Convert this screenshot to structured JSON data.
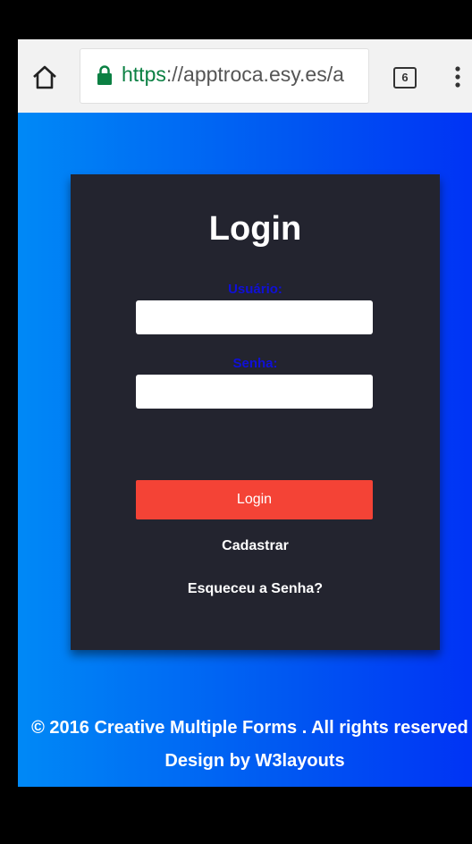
{
  "browser": {
    "url_scheme": "https",
    "url_rest": "://apptroca.esy.es/a",
    "tab_count": "6",
    "icons": [
      "home-icon",
      "lock-icon",
      "tab-switcher-icon",
      "overflow-menu-icon"
    ]
  },
  "login": {
    "title": "Login",
    "username_label": "Usuário:",
    "username_value": "",
    "password_label": "Senha:",
    "password_value": "",
    "submit_label": "Login",
    "register_label": "Cadastrar",
    "forgot_label": "Esqueceu a Senha?"
  },
  "footer": {
    "text": "© 2016 Creative Multiple Forms . All rights reserved | Design by W3layouts"
  },
  "colors": {
    "card_background": "#23242f",
    "button": "#f44336",
    "label": "#1010d8",
    "secure_url": "#0b8043",
    "gradient_start": "#0089f6",
    "gradient_end": "#0033f5"
  }
}
